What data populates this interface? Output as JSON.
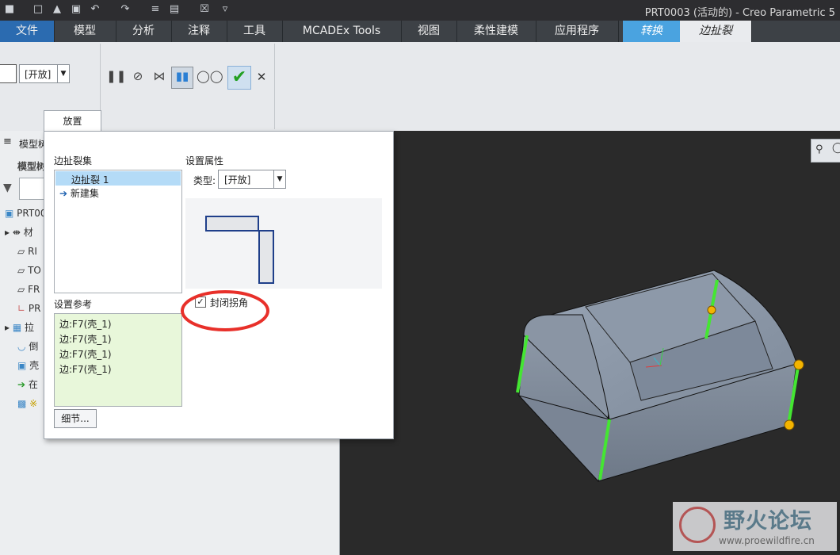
{
  "window": {
    "title": "PRT0003 (活动的) - Creo Parametric 5"
  },
  "tabs": [
    {
      "label": "文件"
    },
    {
      "label": "模型"
    },
    {
      "label": "分析"
    },
    {
      "label": "注释"
    },
    {
      "label": "工具"
    },
    {
      "label": "MCADEx Tools"
    },
    {
      "label": "视图"
    },
    {
      "label": "柔性建模"
    },
    {
      "label": "应用程序"
    },
    {
      "label": "转换"
    },
    {
      "label": "边扯裂"
    }
  ],
  "ribbon": {
    "type_select": "[开放]",
    "panel_tab": "放置"
  },
  "tree": {
    "header": "模型树",
    "subheader": "模型树",
    "items": [
      "PRT00",
      "材",
      "RI",
      "TO",
      "FR",
      "PR",
      "拉",
      "倒",
      "壳",
      "在",
      "※"
    ]
  },
  "dialog": {
    "rip_sets_label": "边扯裂集",
    "rip_set_1": "边扯裂 1",
    "new_set": "新建集",
    "props_label": "设置属性",
    "type_label": "类型:",
    "type_value": "[开放]",
    "close_corner_label": "封闭拐角",
    "close_corner_checked": true,
    "refs_label": "设置参考",
    "refs": [
      "边:F7(壳_1)",
      "边:F7(壳_1)",
      "边:F7(壳_1)",
      "边:F7(壳_1)"
    ],
    "details_button": "细节..."
  },
  "watermark": {
    "site_name": "野火论坛",
    "url": "www.proewildfire.cn"
  },
  "colors": {
    "accent_tab": "#4aa3e0",
    "edge_highlight": "#44e632",
    "annotation_circle": "#e8302a",
    "ref_list_bg": "#e8f7da"
  }
}
